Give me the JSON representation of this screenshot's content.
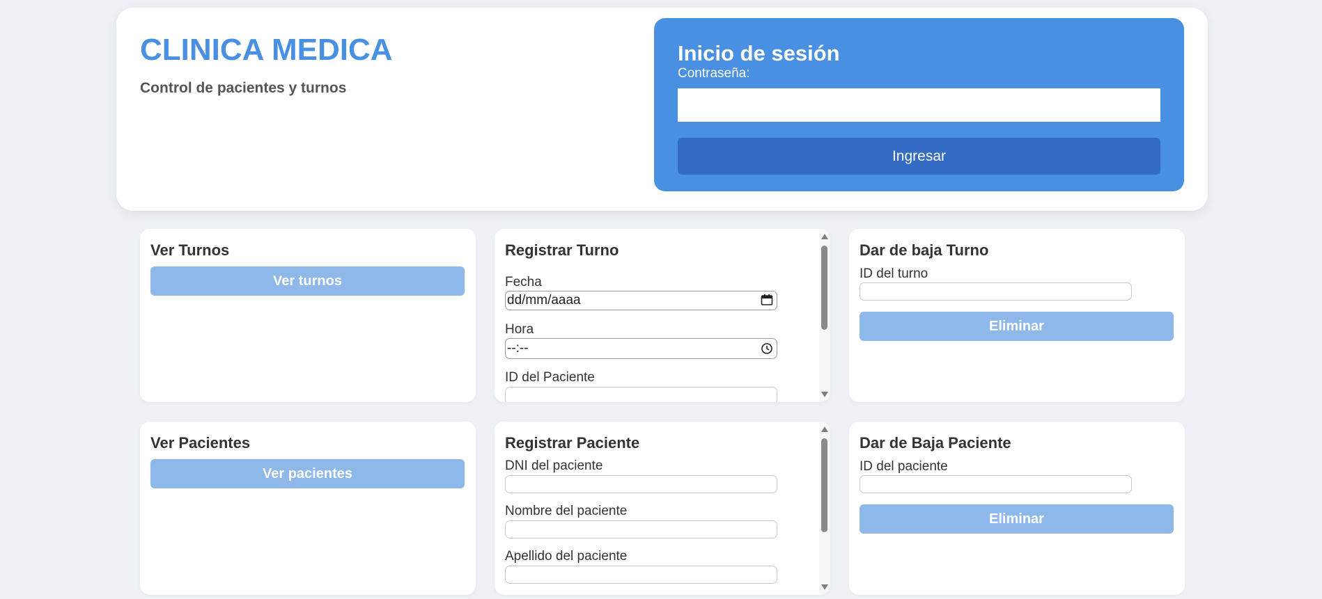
{
  "header": {
    "title": "CLINICA MEDICA",
    "subtitle": "Control de pacientes y turnos"
  },
  "login": {
    "title": "Inicio de sesión",
    "password_label": "Contraseña:",
    "password_value": "",
    "submit_label": "Ingresar"
  },
  "ver_turnos": {
    "title": "Ver Turnos",
    "button_label": "Ver turnos"
  },
  "registrar_turno": {
    "title": "Registrar Turno",
    "fecha_label": "Fecha",
    "fecha_placeholder": "dd/mm/aaaa",
    "hora_label": "Hora",
    "hora_placeholder": "--:--",
    "paciente_label": "ID del Paciente"
  },
  "baja_turno": {
    "title": "Dar de baja Turno",
    "id_label": "ID del turno",
    "button_label": "Eliminar"
  },
  "ver_pacientes": {
    "title": "Ver Pacientes",
    "button_label": "Ver pacientes"
  },
  "registrar_paciente": {
    "title": "Registrar Paciente",
    "dni_label": "DNI del paciente",
    "nombre_label": "Nombre del paciente",
    "apellido_label": "Apellido del paciente"
  },
  "baja_paciente": {
    "title": "Dar de Baja Paciente",
    "id_label": "ID del paciente",
    "button_label": "Eliminar"
  },
  "colors": {
    "accent": "#4a90e2",
    "button_dark": "#346bc4",
    "button_light": "#8db8e9",
    "background": "#eef2f7"
  },
  "icons": [
    "calendar-icon",
    "clock-icon",
    "scroll-up-arrow",
    "scroll-down-arrow"
  ]
}
